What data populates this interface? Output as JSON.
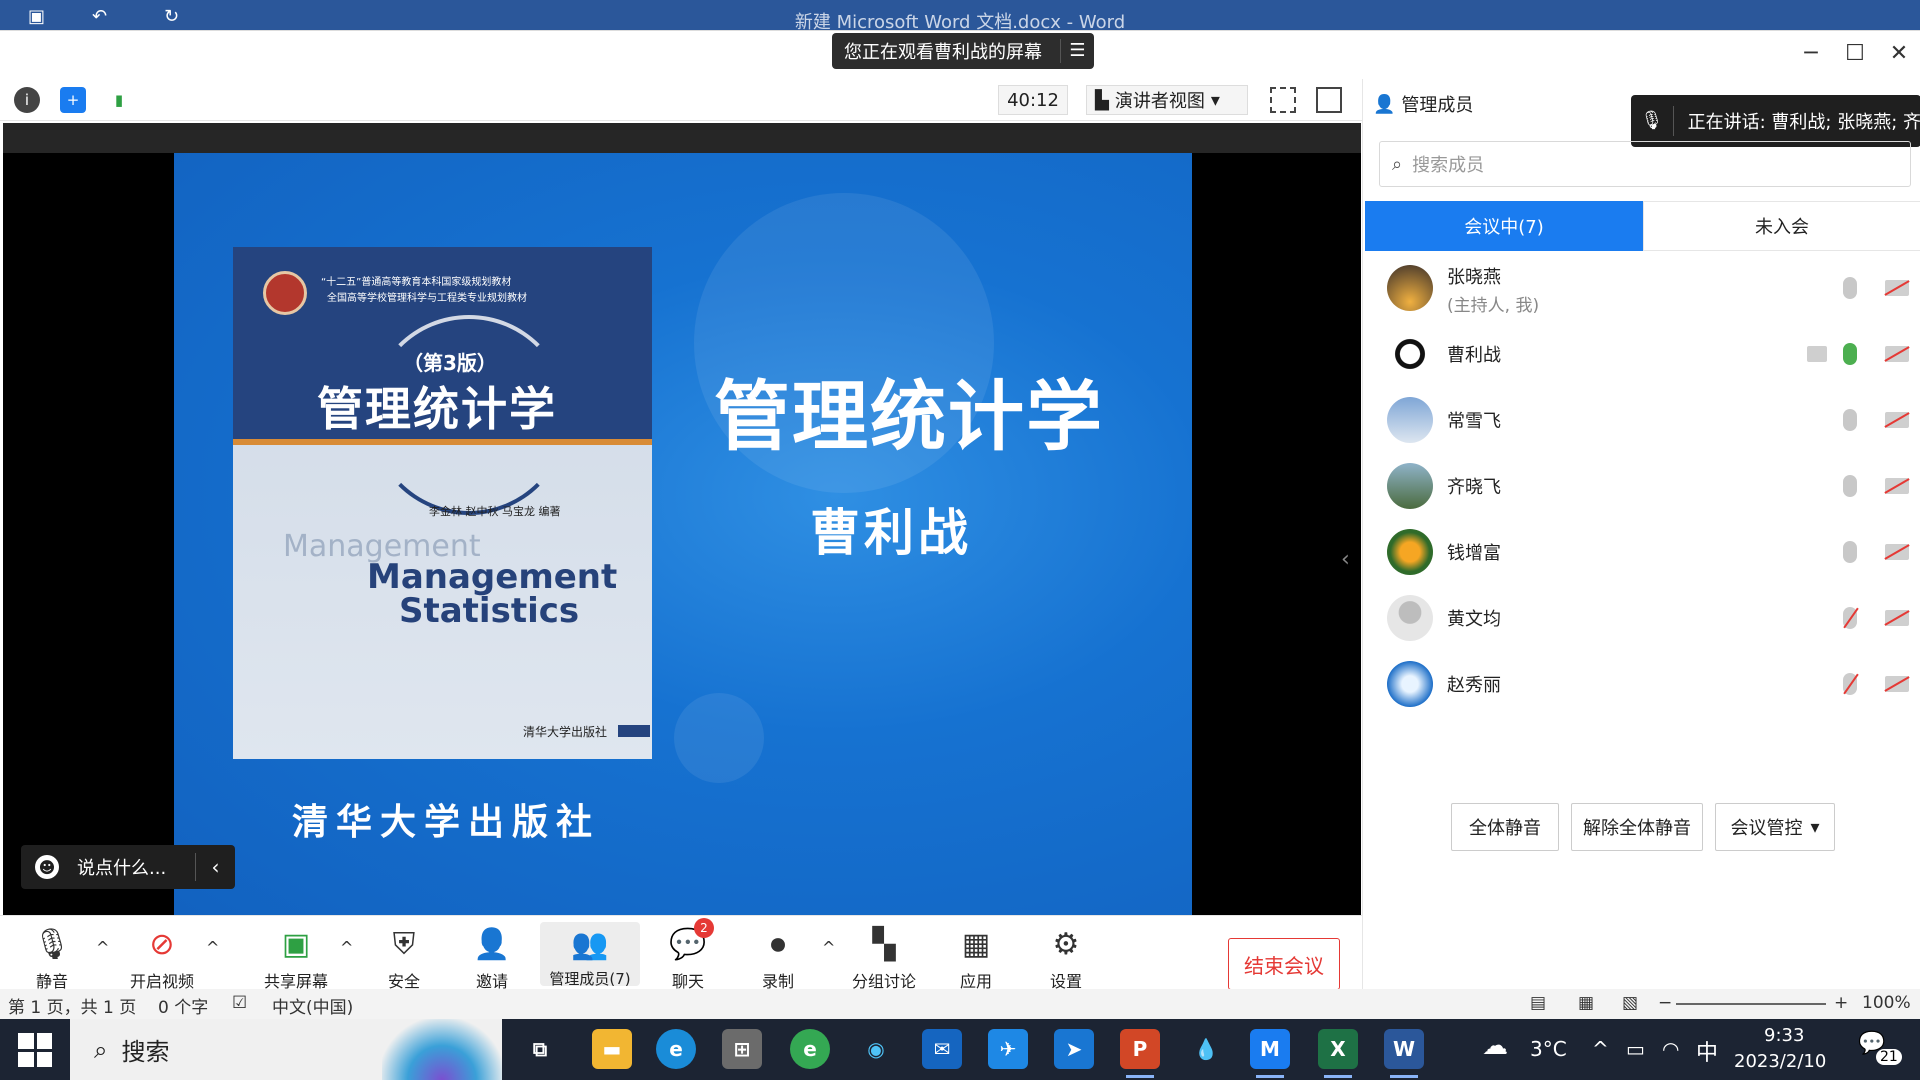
{
  "word": {
    "title": "新建 Microsoft Word 文档.docx - Word",
    "status": {
      "page": "第 1 页，共 1 页",
      "words": "0 个字",
      "lang": "中文(中国)",
      "zoom": "100%"
    }
  },
  "meeting": {
    "share_banner": "您正在观看曹利战的屏幕",
    "timer": "40:12",
    "view_mode": "演讲者视图",
    "chat_placeholder": "说点什么..."
  },
  "slide": {
    "title": "管理统计学",
    "author": "曹利战",
    "publisher": "清华大学出版社",
    "book": {
      "series1": "“十二五”普通高等教育本科国家级规划教材",
      "series2": "全国高等学校管理科学与工程类专业规划教材",
      "edition": "（第3版）",
      "title": "管理统计学",
      "authors": "李金林  赵中秋  马宝龙  编著",
      "en_ghost": "Management",
      "en1": "Management",
      "en2": "Statistics",
      "press": "清华大学出版社"
    }
  },
  "panel": {
    "title": "管理成员",
    "speaking": "正在讲话: 曹利战; 张晓燕; 齐",
    "search_placeholder": "搜索成员",
    "tabs": [
      "会议中(7)",
      "未入会"
    ],
    "members": [
      {
        "name": "张晓燕",
        "role": "(主持人, 我)"
      },
      {
        "name": "曹利战",
        "role": ""
      },
      {
        "name": "常雪飞",
        "role": ""
      },
      {
        "name": "齐晓飞",
        "role": ""
      },
      {
        "name": "钱增富",
        "role": ""
      },
      {
        "name": "黄文均",
        "role": ""
      },
      {
        "name": "赵秀丽",
        "role": ""
      }
    ],
    "buttons": {
      "mute_all": "全体静音",
      "unmute_all": "解除全体静音",
      "control": "会议管控"
    }
  },
  "controls": {
    "mute": "静音",
    "video": "开启视频",
    "share": "共享屏幕",
    "security": "安全",
    "invite": "邀请",
    "members": "管理成员(7)",
    "chat": "聊天",
    "chat_badge": "2",
    "record": "录制",
    "breakout": "分组讨论",
    "apps": "应用",
    "settings": "设置",
    "end": "结束会议"
  },
  "taskbar": {
    "search": "搜索",
    "weather": "3°C",
    "ime": "中",
    "time": "9:33",
    "date": "2023/2/10",
    "notif": "21"
  }
}
